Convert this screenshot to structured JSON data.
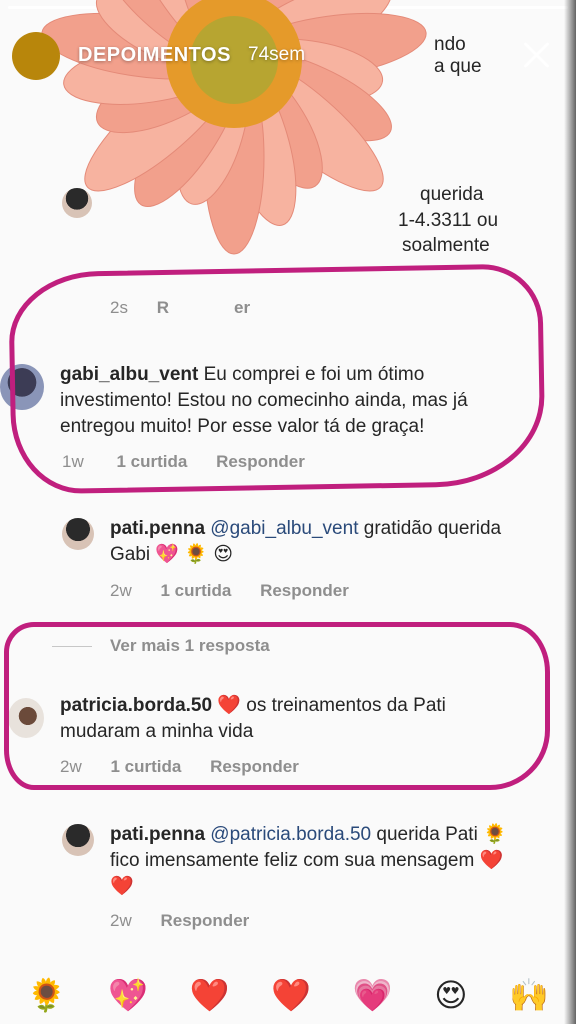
{
  "story": {
    "title": "DEPOIMENTOS",
    "time": "74sem",
    "progress": 1.0
  },
  "hidden_fragments": {
    "line1": "ndo",
    "line2": "a que",
    "line3": "querida",
    "line4": "1-4.3311 ou",
    "line5": "soalmente",
    "meta_time": "2s",
    "meta_action": "R",
    "meta_action2": "er"
  },
  "comments": [
    {
      "username": "gabi_albu_vent",
      "text": "Eu comprei e foi um ótimo investimento! Estou no comecinho ainda, mas já entregou muito! Por esse valor tá de graça!",
      "time": "1w",
      "likes": "1 curtida",
      "reply": "Responder"
    },
    {
      "username": "pati.penna",
      "mention": "@gabi_albu_vent",
      "text": "gratidão querida Gabi 💖 🌻 😍",
      "time": "2w",
      "likes": "1 curtida",
      "reply": "Responder"
    },
    {
      "view_more": "Ver mais 1 resposta"
    },
    {
      "username": "patricia.borda.50",
      "text": "❤️ os treinamentos da Pati mudaram a minha vida",
      "time": "2w",
      "likes": "1 curtida",
      "reply": "Responder"
    },
    {
      "username": "pati.penna",
      "mention": "@patricia.borda.50",
      "text": "querida Pati 🌻 fico imensamente feliz com sua mensagem ❤️ ❤️",
      "time": "2w",
      "reply": "Responder"
    }
  ],
  "emoji_bar": [
    "🌻",
    "💖",
    "❤️",
    "❤️",
    "💗",
    "😍",
    "🙌"
  ],
  "colors": {
    "highlight": "#c01f7e",
    "meta": "#8e8e8e",
    "mention": "#2a4a7a"
  }
}
